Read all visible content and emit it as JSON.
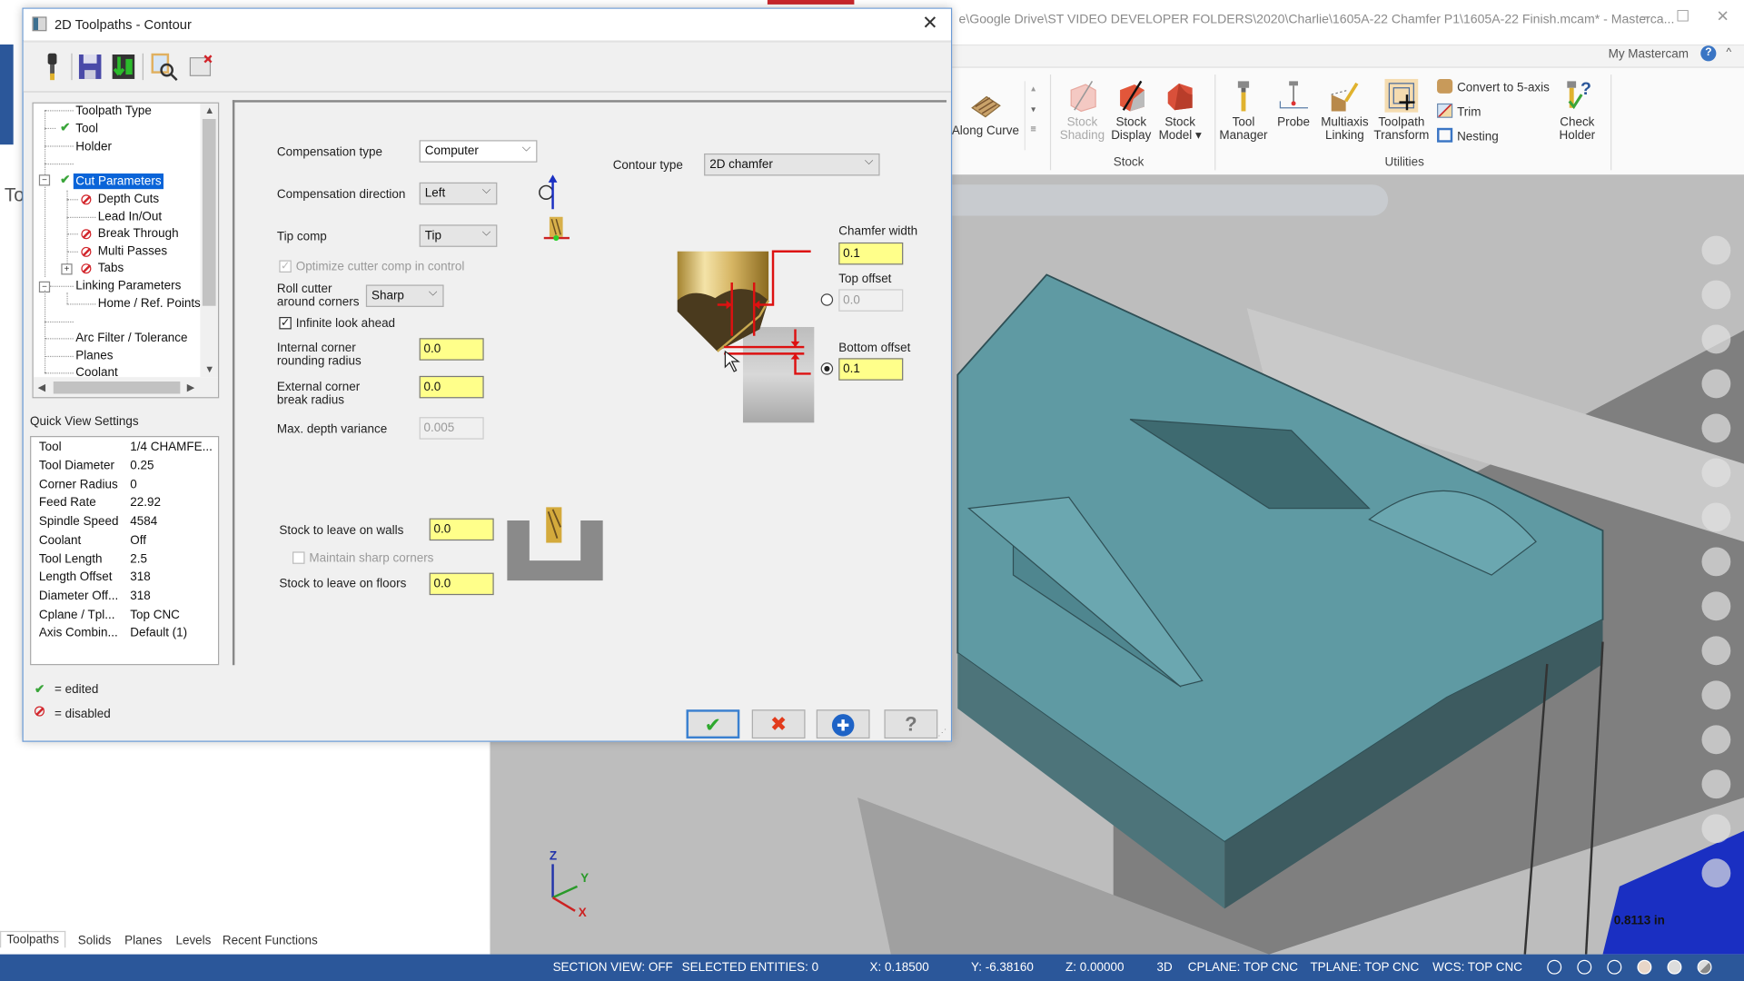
{
  "app": {
    "title": "e\\Google Drive\\ST VIDEO DEVELOPER FOLDERS\\2020\\Charlie\\1605A-22 Chamfer P1\\1605A-22 Finish.mcam* - Masterca...",
    "window_controls": {
      "minimize": "–",
      "maximize": "☐",
      "close": "✕"
    },
    "my_mastercam": "My Mastercam",
    "help": "?",
    "collapse_ribbon": "^"
  },
  "ribbon": {
    "gallery_item": "Along Curve",
    "gallery_controls": [
      "▴",
      "▾",
      "≡"
    ],
    "groups": [
      {
        "label": "Stock",
        "buttons": [
          {
            "label": "Stock Shading",
            "line1": "Stock",
            "line2": "Shading",
            "enabled": false
          },
          {
            "label": "Stock Display",
            "line1": "Stock",
            "line2": "Display",
            "enabled": true
          },
          {
            "label": "Stock Model",
            "line1": "Stock",
            "line2": "Model ▾",
            "enabled": true
          }
        ]
      },
      {
        "label": "Utilities",
        "buttons": [
          {
            "label": "Tool Manager",
            "line1": "Tool",
            "line2": "Manager"
          },
          {
            "label": "Probe",
            "line1": "Probe",
            "line2": ""
          },
          {
            "label": "Multiaxis Linking",
            "line1": "Multiaxis",
            "line2": "Linking"
          },
          {
            "label": "Toolpath Transform",
            "line1": "Toolpath",
            "line2": "Transform"
          }
        ],
        "small_buttons": [
          "Convert to 5-axis",
          "Trim",
          "Nesting"
        ],
        "extra": {
          "line1": "Check",
          "line2": "Holder"
        }
      }
    ]
  },
  "left_panel": {
    "partial_title": "To",
    "bottom_tabs": [
      {
        "label": "Toolpaths",
        "active": true
      },
      {
        "label": "Solids",
        "active": false
      },
      {
        "label": "Planes",
        "active": false
      },
      {
        "label": "Levels",
        "active": false
      },
      {
        "label": "Recent Functions",
        "active": false
      }
    ]
  },
  "dialog": {
    "title": "2D Toolpaths - Contour",
    "close": "✕",
    "toolbar": [
      {
        "name": "tool-icon",
        "tooltip": "Tool"
      },
      {
        "name": "save-icon",
        "tooltip": "Save"
      },
      {
        "name": "save-default-icon",
        "tooltip": "Save to defaults"
      },
      {
        "name": "preview-icon",
        "tooltip": "Preview"
      },
      {
        "name": "clear-icon",
        "tooltip": "Clear"
      }
    ],
    "tree": [
      {
        "label": "Toolpath Type",
        "level": 0,
        "status": ""
      },
      {
        "label": "Tool",
        "level": 0,
        "status": "edited"
      },
      {
        "label": "Holder",
        "level": 0,
        "status": ""
      },
      {
        "label": "",
        "level": 0,
        "status": ""
      },
      {
        "label": "Cut Parameters",
        "level": 0,
        "status": "edited",
        "selected": true,
        "expander": "−"
      },
      {
        "label": "Depth Cuts",
        "level": 1,
        "status": "disabled"
      },
      {
        "label": "Lead In/Out",
        "level": 1,
        "status": ""
      },
      {
        "label": "Break Through",
        "level": 1,
        "status": "disabled"
      },
      {
        "label": "Multi Passes",
        "level": 1,
        "status": "disabled"
      },
      {
        "label": "Tabs",
        "level": 1,
        "status": "disabled",
        "expander": "+"
      },
      {
        "label": "Linking Parameters",
        "level": 0,
        "status": "",
        "expander": "−"
      },
      {
        "label": "Home / Ref. Points",
        "level": 1,
        "status": ""
      },
      {
        "label": "",
        "level": 0,
        "status": ""
      },
      {
        "label": "Arc Filter / Tolerance",
        "level": 0,
        "status": ""
      },
      {
        "label": "Planes",
        "level": 0,
        "status": ""
      },
      {
        "label": "Coolant",
        "level": 0,
        "status": ""
      }
    ],
    "quick_view": {
      "title": "Quick View Settings",
      "rows": [
        {
          "key": "Tool",
          "value": "1/4 CHAMFE..."
        },
        {
          "key": "Tool Diameter",
          "value": "0.25"
        },
        {
          "key": "Corner Radius",
          "value": "0"
        },
        {
          "key": "Feed Rate",
          "value": "22.92"
        },
        {
          "key": "Spindle Speed",
          "value": "4584"
        },
        {
          "key": "Coolant",
          "value": "Off"
        },
        {
          "key": "Tool Length",
          "value": "2.5"
        },
        {
          "key": "Length Offset",
          "value": "318"
        },
        {
          "key": "Diameter Off...",
          "value": "318"
        },
        {
          "key": "Cplane / Tpl...",
          "value": "Top CNC"
        },
        {
          "key": "Axis Combin...",
          "value": "Default (1)"
        }
      ]
    },
    "legend": {
      "edited": "= edited",
      "disabled": "= disabled"
    },
    "params": {
      "compensation_type": {
        "label": "Compensation type",
        "value": "Computer"
      },
      "compensation_direction": {
        "label": "Compensation direction",
        "value": "Left"
      },
      "tip_comp": {
        "label": "Tip comp",
        "value": "Tip"
      },
      "optimize_cutter_comp": {
        "label": "Optimize cutter comp in control",
        "checked": true,
        "enabled": false
      },
      "roll_cutter": {
        "label_line1": "Roll cutter",
        "label_line2": "around corners",
        "value": "Sharp"
      },
      "infinite_look_ahead": {
        "label": "Infinite look ahead",
        "checked": true
      },
      "internal_corner": {
        "label_line1": "Internal corner",
        "label_line2": "rounding radius",
        "value": "0.0"
      },
      "external_corner": {
        "label_line1": "External corner",
        "label_line2": "break radius",
        "value": "0.0"
      },
      "max_depth_variance": {
        "label": "Max. depth variance",
        "value": "0.005",
        "enabled": false
      },
      "contour_type": {
        "label": "Contour type",
        "value": "2D chamfer"
      },
      "chamfer_width": {
        "label": "Chamfer width",
        "value": "0.1"
      },
      "top_offset": {
        "label": "Top offset",
        "value": "0.0",
        "selected": false
      },
      "bottom_offset": {
        "label": "Bottom offset",
        "value": "0.1",
        "selected": true
      },
      "stock_walls": {
        "label": "Stock to leave on walls",
        "value": "0.0"
      },
      "maintain_sharp": {
        "label": "Maintain sharp corners",
        "checked": false,
        "enabled": false
      },
      "stock_floors": {
        "label": "Stock to leave on floors",
        "value": "0.0"
      }
    },
    "buttons": {
      "ok": "✔",
      "cancel": "✖",
      "apply": "✚",
      "help": "?"
    }
  },
  "viewport": {
    "axes": {
      "x": "X",
      "y": "Y",
      "z": "Z"
    },
    "scale_text": "0.8113 in"
  },
  "statusbar": {
    "section_view": "SECTION VIEW: OFF",
    "selected_entities": "SELECTED ENTITIES: 0",
    "x": "X:  0.18500",
    "y": "Y:  -6.38160",
    "z": "Z:  0.00000",
    "mode": "3D",
    "cplane": "CPLANE: TOP CNC",
    "tplane": "TPLANE: TOP CNC",
    "wcs": "WCS: TOP CNC"
  },
  "colors": {
    "accent": "#2b579a",
    "selection": "#0a64d8",
    "field_highlight": "#ffff8a",
    "edited": "#3aa53a",
    "disabled": "#d2252b",
    "part": "#5f9aa3"
  }
}
